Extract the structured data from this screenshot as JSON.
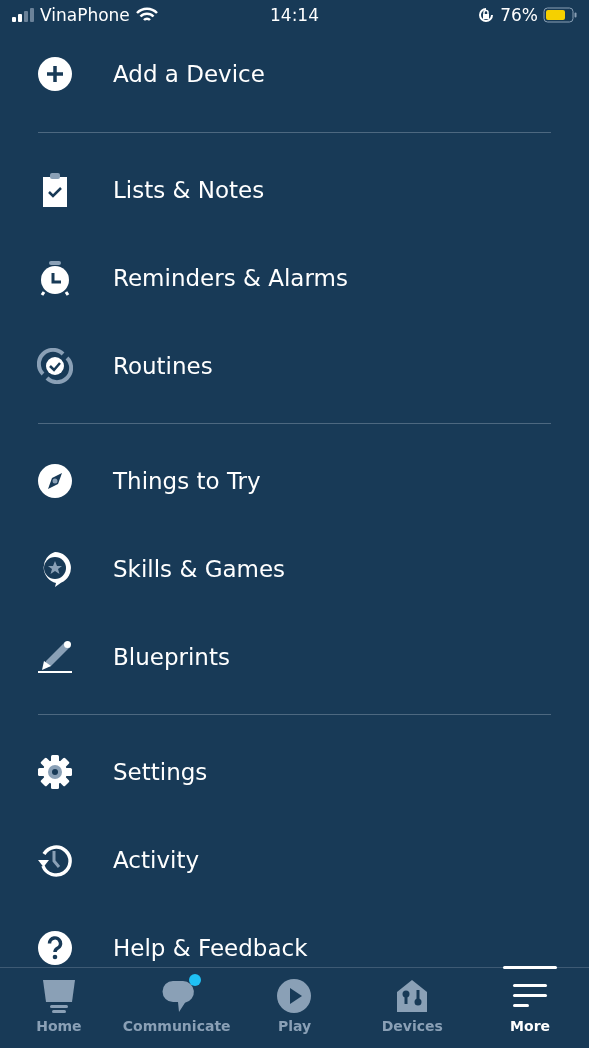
{
  "status_bar": {
    "carrier": "VinaPhone",
    "time": "14:14",
    "battery": "76%"
  },
  "menu": {
    "groups": [
      {
        "items": [
          {
            "label": "Add a Device"
          }
        ]
      },
      {
        "items": [
          {
            "label": "Lists & Notes"
          },
          {
            "label": "Reminders & Alarms"
          },
          {
            "label": "Routines"
          }
        ]
      },
      {
        "items": [
          {
            "label": "Things to Try"
          },
          {
            "label": "Skills & Games"
          },
          {
            "label": "Blueprints"
          }
        ]
      },
      {
        "items": [
          {
            "label": "Settings"
          },
          {
            "label": "Activity"
          },
          {
            "label": "Help & Feedback"
          }
        ]
      }
    ]
  },
  "tab_bar": {
    "tabs": [
      {
        "label": "Home",
        "selected": false,
        "notification": false
      },
      {
        "label": "Communicate",
        "selected": false,
        "notification": true
      },
      {
        "label": "Play",
        "selected": false,
        "notification": false
      },
      {
        "label": "Devices",
        "selected": false,
        "notification": false
      },
      {
        "label": "More",
        "selected": true,
        "notification": false
      }
    ]
  }
}
